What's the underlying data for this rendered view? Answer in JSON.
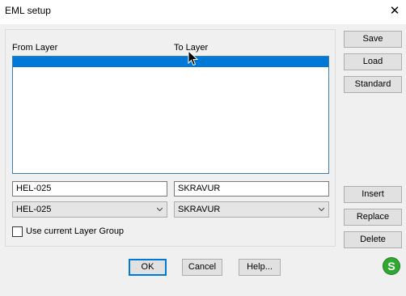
{
  "window": {
    "title": "EML setup"
  },
  "list": {
    "from_header": "From Layer",
    "to_header": "To Layer"
  },
  "inputs": {
    "from_value": "HEL-025",
    "to_value": "SKRAVUR"
  },
  "combos": {
    "from_selected": "HEL-025",
    "to_selected": "SKRAVUR"
  },
  "checkbox": {
    "label": "Use current Layer Group",
    "checked": false
  },
  "side_buttons": {
    "save": "Save",
    "load": "Load",
    "standard": "Standard",
    "insert": "Insert",
    "replace": "Replace",
    "delete": "Delete"
  },
  "bottom_buttons": {
    "ok": "OK",
    "cancel": "Cancel",
    "help": "Help..."
  },
  "badge": {
    "letter": "S",
    "color": "#2fa82f"
  },
  "colors": {
    "selection": "#0078d7",
    "dialog_bg": "#f0f0f0"
  }
}
